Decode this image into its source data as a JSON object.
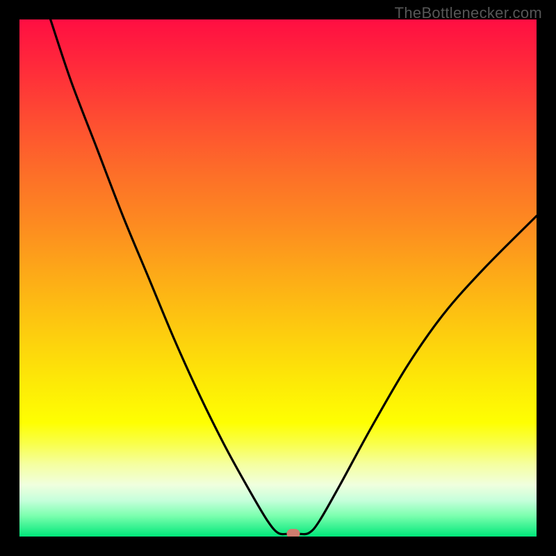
{
  "watermark": "TheBottlenecker.com",
  "chart_data": {
    "type": "line",
    "title": "",
    "xlabel": "",
    "ylabel": "",
    "xlim": [
      0,
      100
    ],
    "ylim": [
      0,
      100
    ],
    "background_gradient": {
      "stops": [
        {
          "offset": 0.0,
          "color": "#ff0e42"
        },
        {
          "offset": 0.1,
          "color": "#ff2d3a"
        },
        {
          "offset": 0.2,
          "color": "#fe4f31"
        },
        {
          "offset": 0.3,
          "color": "#fd6f28"
        },
        {
          "offset": 0.4,
          "color": "#fd8c20"
        },
        {
          "offset": 0.5,
          "color": "#fdac17"
        },
        {
          "offset": 0.6,
          "color": "#fdcb0f"
        },
        {
          "offset": 0.7,
          "color": "#fde907"
        },
        {
          "offset": 0.78,
          "color": "#feff02"
        },
        {
          "offset": 0.82,
          "color": "#f9ff4a"
        },
        {
          "offset": 0.86,
          "color": "#f5ffa0"
        },
        {
          "offset": 0.9,
          "color": "#f0ffde"
        },
        {
          "offset": 0.93,
          "color": "#c6ffdb"
        },
        {
          "offset": 0.96,
          "color": "#7bffae"
        },
        {
          "offset": 1.0,
          "color": "#00e77a"
        }
      ]
    },
    "series": [
      {
        "name": "bottleneck-curve",
        "x": [
          6,
          10,
          15,
          20,
          25,
          30,
          35,
          40,
          45,
          48,
          50,
          52,
          54,
          56,
          58,
          62,
          68,
          75,
          82,
          90,
          100
        ],
        "y": [
          100,
          88,
          75,
          62,
          50,
          38,
          27,
          17,
          8,
          3,
          0.7,
          0.5,
          0.5,
          0.7,
          3,
          10,
          21,
          33,
          43,
          52,
          62
        ]
      }
    ],
    "marker": {
      "x": 53,
      "y": 0.5,
      "color": "#cf7d6f"
    }
  }
}
